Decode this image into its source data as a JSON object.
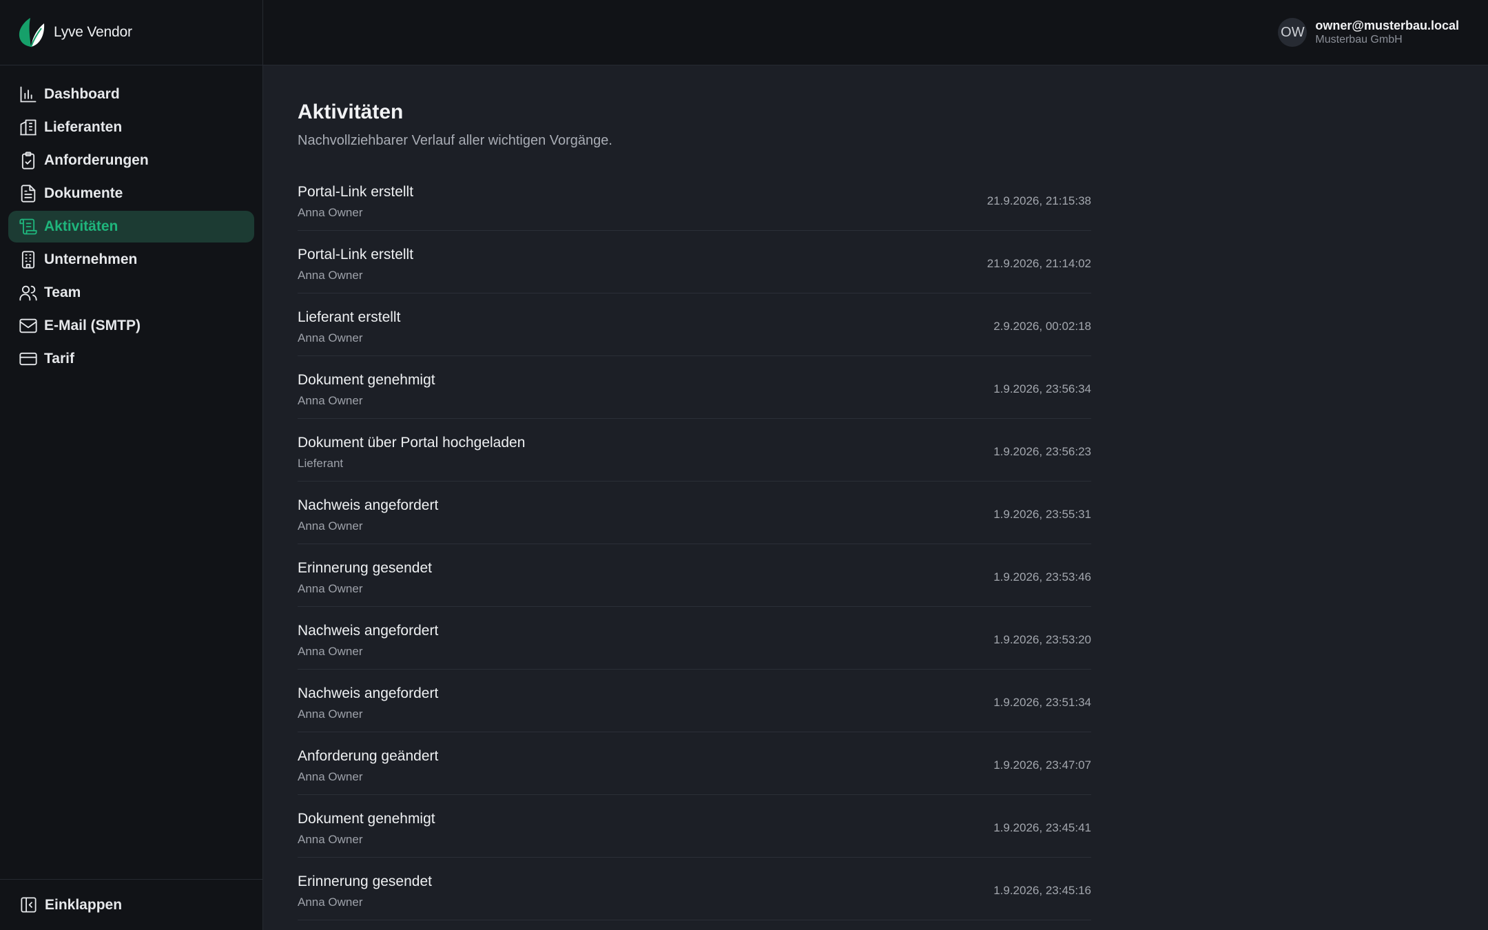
{
  "app": {
    "name": "Lyve Vendor"
  },
  "nav": {
    "items": [
      {
        "label": "Dashboard",
        "icon": "bar-chart-icon",
        "active": false
      },
      {
        "label": "Lieferanten",
        "icon": "building-icon",
        "active": false
      },
      {
        "label": "Anforderungen",
        "icon": "clipboard-check-icon",
        "active": false
      },
      {
        "label": "Dokumente",
        "icon": "document-icon",
        "active": false
      },
      {
        "label": "Aktivitäten",
        "icon": "scroll-text-icon",
        "active": true
      },
      {
        "label": "Unternehmen",
        "icon": "office-building-icon",
        "active": false
      },
      {
        "label": "Team",
        "icon": "users-icon",
        "active": false
      },
      {
        "label": "E-Mail (SMTP)",
        "icon": "mail-icon",
        "active": false
      },
      {
        "label": "Tarif",
        "icon": "credit-card-icon",
        "active": false
      }
    ],
    "collapse_label": "Einklappen"
  },
  "user": {
    "initials": "OW",
    "email": "owner@musterbau.local",
    "company": "Musterbau GmbH"
  },
  "page": {
    "title": "Aktivitäten",
    "subtitle": "Nachvollziehbarer Verlauf aller wichtigen Vorgänge."
  },
  "activities": [
    {
      "title": "Portal-Link erstellt",
      "actor": "Anna Owner",
      "time": "21.9.2026, 21:15:38"
    },
    {
      "title": "Portal-Link erstellt",
      "actor": "Anna Owner",
      "time": "21.9.2026, 21:14:02"
    },
    {
      "title": "Lieferant erstellt",
      "actor": "Anna Owner",
      "time": "2.9.2026, 00:02:18"
    },
    {
      "title": "Dokument genehmigt",
      "actor": "Anna Owner",
      "time": "1.9.2026, 23:56:34"
    },
    {
      "title": "Dokument über Portal hochgeladen",
      "actor": "Lieferant",
      "time": "1.9.2026, 23:56:23"
    },
    {
      "title": "Nachweis angefordert",
      "actor": "Anna Owner",
      "time": "1.9.2026, 23:55:31"
    },
    {
      "title": "Erinnerung gesendet",
      "actor": "Anna Owner",
      "time": "1.9.2026, 23:53:46"
    },
    {
      "title": "Nachweis angefordert",
      "actor": "Anna Owner",
      "time": "1.9.2026, 23:53:20"
    },
    {
      "title": "Nachweis angefordert",
      "actor": "Anna Owner",
      "time": "1.9.2026, 23:51:34"
    },
    {
      "title": "Anforderung geändert",
      "actor": "Anna Owner",
      "time": "1.9.2026, 23:47:07"
    },
    {
      "title": "Dokument genehmigt",
      "actor": "Anna Owner",
      "time": "1.9.2026, 23:45:41"
    },
    {
      "title": "Erinnerung gesendet",
      "actor": "Anna Owner",
      "time": "1.9.2026, 23:45:16"
    }
  ],
  "colors": {
    "accent": "#1fb57c",
    "active_bg": "#1c3b33",
    "sidebar_bg": "#111317",
    "main_bg": "#1c1f26"
  }
}
